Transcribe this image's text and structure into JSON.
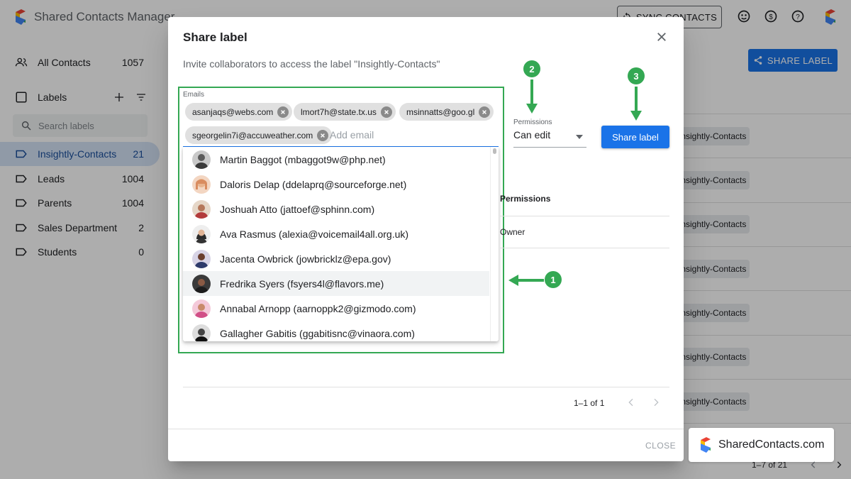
{
  "app": {
    "title": "Shared Contacts Manager",
    "sync_button": "SYNC CONTACTS",
    "share_label_button": "SHARE LABEL",
    "icons": [
      "face-icon",
      "dollar-icon",
      "help-icon",
      "app-logo-icon"
    ]
  },
  "sidebar": {
    "all_contacts": {
      "label": "All Contacts",
      "count": "1057"
    },
    "labels_header": "Labels",
    "search_placeholder": "Search labels",
    "items": [
      {
        "label": "Insightly-Contacts",
        "count": "21"
      },
      {
        "label": "Leads",
        "count": "1004"
      },
      {
        "label": "Parents",
        "count": "1004"
      },
      {
        "label": "Sales Department",
        "count": "2"
      },
      {
        "label": "Students",
        "count": "0"
      }
    ]
  },
  "background_table": {
    "chip_text": "Insightly-Contacts",
    "pager": "1–7 of 21"
  },
  "dialog": {
    "title": "Share label",
    "subtitle": "Invite collaborators to access the label \"Insightly-Contacts\"",
    "emails_label": "Emails",
    "chips": [
      "asanjaqs@webs.com",
      "lmort7h@state.tx.us",
      "msinnatts@goo.gl",
      "sgeorgelin7i@accuweather.com"
    ],
    "add_email_placeholder": "Add email",
    "permissions_label": "Permissions",
    "permissions_value": "Can edit",
    "share_button": "Share label",
    "table_header_permissions": "Permissions",
    "table_owner": "Owner",
    "pager": "1–1 of 1",
    "close_button": "CLOSE",
    "suggestions": [
      {
        "name": "Martin Baggot (mbaggot9w@php.net)"
      },
      {
        "name": "Daloris Delap (ddelaprq@sourceforge.net)"
      },
      {
        "name": "Joshuah Atto (jattoef@sphinn.com)"
      },
      {
        "name": "Ava Rasmus (alexia@voicemail4all.org.uk)"
      },
      {
        "name": "Jacenta Owbrick (jowbricklz@epa.gov)"
      },
      {
        "name": "Fredrika Syers (fsyers4l@flavors.me)"
      },
      {
        "name": "Annabal Arnopp (aarnoppk2@gizmodo.com)"
      },
      {
        "name": "Gallagher Gabitis (ggabitisnc@vinaora.com)"
      }
    ]
  },
  "annotations": {
    "step1": "1",
    "step2": "2",
    "step3": "3",
    "color": "#34a853"
  },
  "watermark": {
    "text": "SharedContacts.com"
  }
}
